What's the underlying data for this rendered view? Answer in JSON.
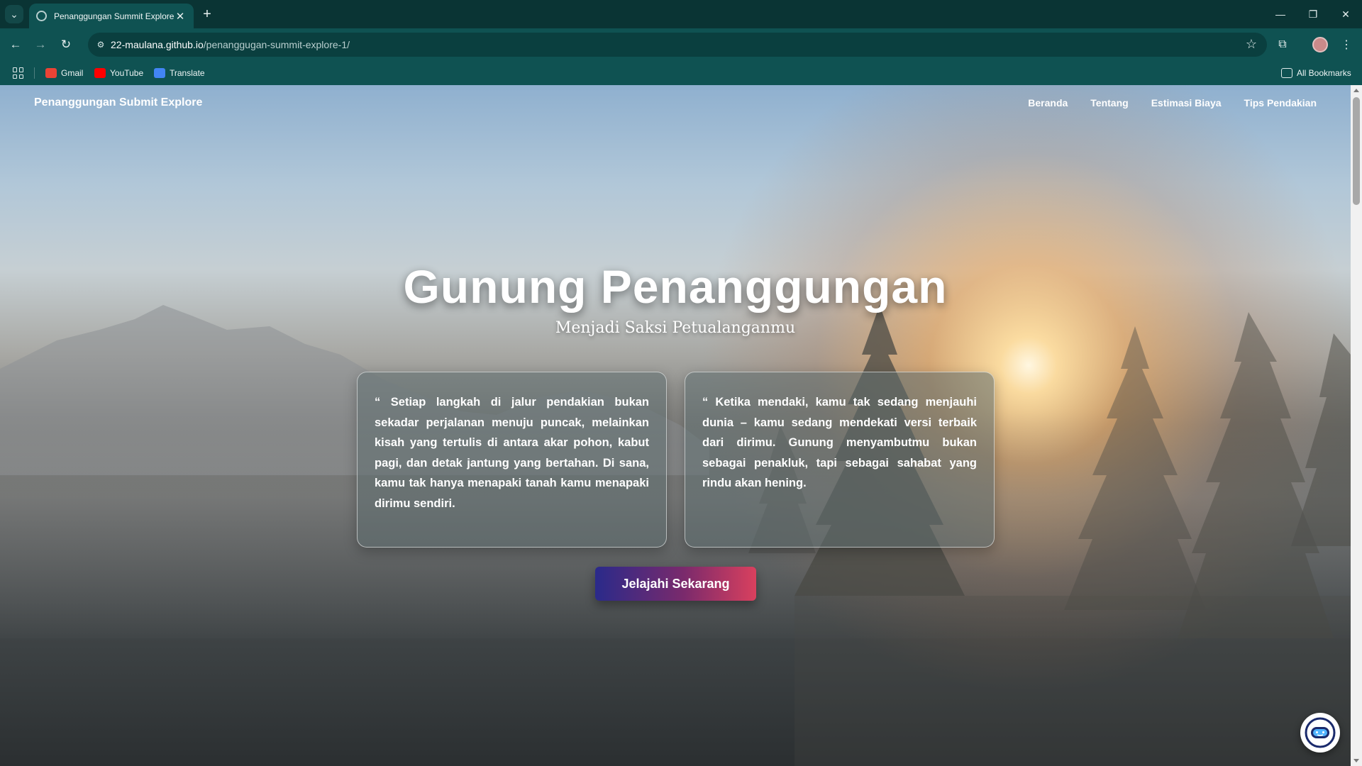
{
  "browser": {
    "tab_title": "Penanggungan Summit Explore",
    "tab_close": "✕",
    "new_tab": "+",
    "url_host": "22-maulana.github.io",
    "url_path": "/penanggugan-summit-explore-1/",
    "bookmarks": [
      {
        "label": "Gmail",
        "icon": "gmail-icon",
        "color": "#ea4335"
      },
      {
        "label": "YouTube",
        "icon": "youtube-icon",
        "color": "#ff0000"
      },
      {
        "label": "Translate",
        "icon": "translate-icon",
        "color": "#4285f4"
      }
    ],
    "all_bookmarks": "All Bookmarks",
    "theme_color": "#0f5252"
  },
  "site": {
    "brand": "Penanggungan Submit Explore",
    "nav": [
      "Beranda",
      "Tentang",
      "Estimasi Biaya",
      "Tips Pendakian"
    ]
  },
  "hero": {
    "title": "Gunung Penanggungan",
    "subtitle": "Menjadi Saksi Petualanganmu",
    "quotes": [
      "“ Setiap langkah di jalur pendakian bukan sekadar perjalanan menuju puncak, melainkan kisah yang tertulis di antara akar pohon, kabut pagi, dan detak jantung yang bertahan. Di sana, kamu tak hanya menapaki tanah kamu menapaki dirimu sendiri.",
      "“ Ketika mendaki, kamu tak sedang menjauhi dunia – kamu sedang mendekati versi terbaik dari dirimu. Gunung menyambutmu bukan sebagai penakluk, tapi sebagai sahabat yang rindu akan hening."
    ],
    "cta": "Jelajahi Sekarang",
    "cta_colors": [
      "#2a2a8a",
      "#d9405e"
    ]
  }
}
